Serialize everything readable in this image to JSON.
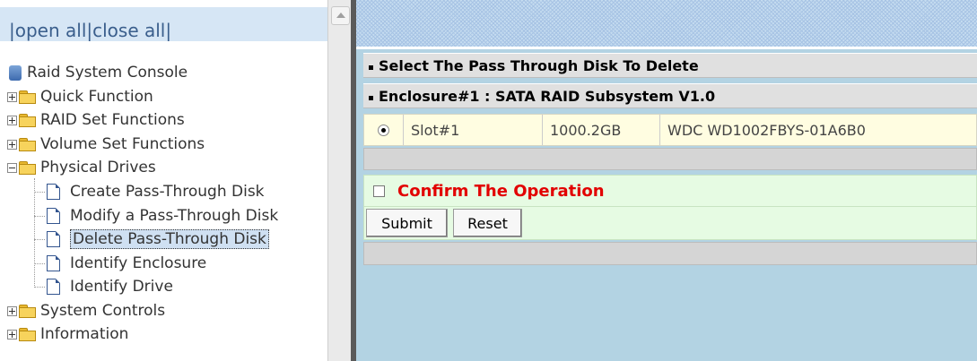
{
  "left_panel": {
    "open_close_text": "|open all|close all|",
    "tree": {
      "root_label": "Raid System Console",
      "items": [
        {
          "label": "Quick Function",
          "expanded": false
        },
        {
          "label": "RAID Set Functions",
          "expanded": false
        },
        {
          "label": "Volume Set Functions",
          "expanded": false
        },
        {
          "label": "Physical Drives",
          "expanded": true
        },
        {
          "label": "System Controls",
          "expanded": false
        },
        {
          "label": "Information",
          "expanded": false
        }
      ],
      "physical_drives_children": [
        {
          "label": "Create Pass-Through Disk"
        },
        {
          "label": "Modify a Pass-Through Disk"
        },
        {
          "label": "Delete Pass-Through Disk",
          "selected": true
        },
        {
          "label": "Identify Enclosure"
        },
        {
          "label": "Identify Drive"
        }
      ]
    }
  },
  "main": {
    "section_title": "Select The Pass Through Disk To Delete",
    "enclosure_title": "Enclosure#1 : SATA RAID Subsystem V1.0",
    "disk_row": {
      "selected": true,
      "slot": "Slot#1",
      "capacity": "1000.2GB",
      "model": "WDC WD1002FBYS-01A6B0"
    },
    "confirm_label": "Confirm The Operation",
    "confirm_checked": false,
    "submit_label": "Submit",
    "reset_label": "Reset"
  },
  "colors": {
    "confirm_text": "#e20000",
    "header_bg": "#e0e0e0",
    "row_bg": "#fffde1",
    "confirm_bg": "#e6fbe3",
    "content_bg": "#b3d3e3"
  }
}
